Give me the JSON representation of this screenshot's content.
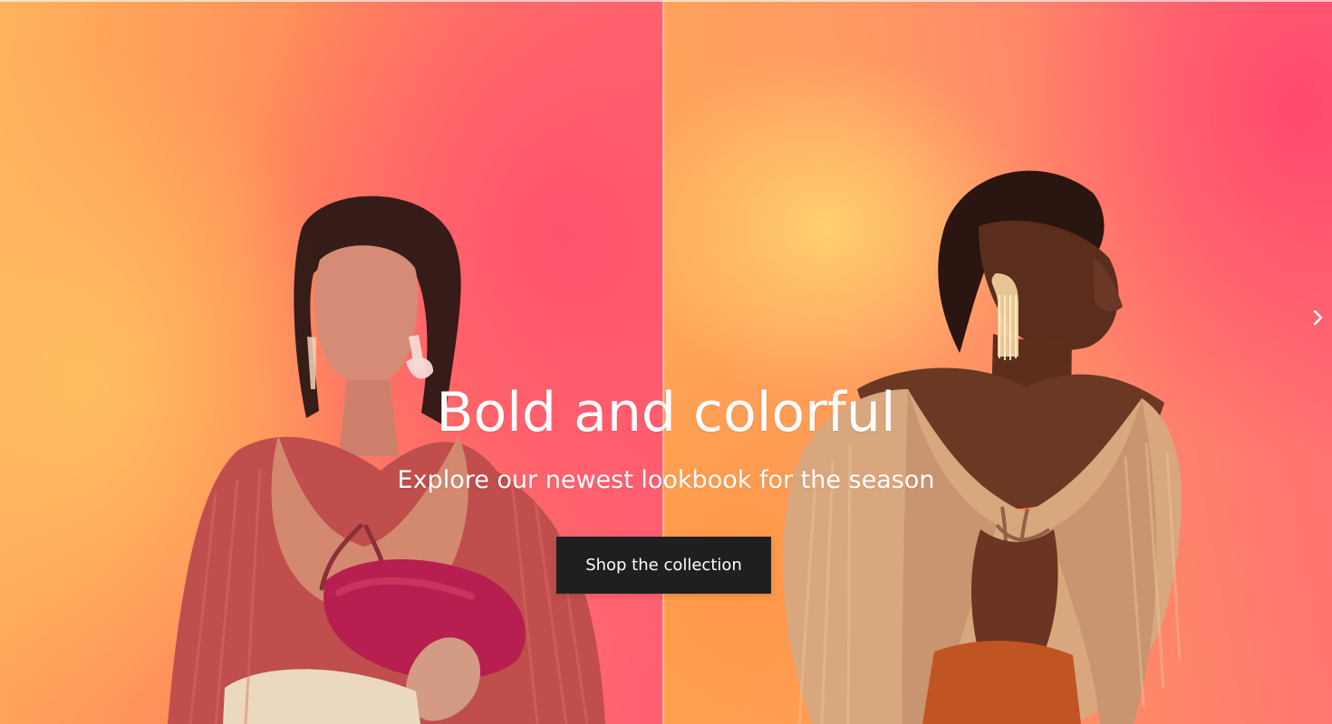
{
  "hero": {
    "title": "Bold and colorful",
    "subtitle": "Explore our newest lookbook for the season",
    "cta_label": "Shop the collection"
  },
  "controls": {
    "next_icon": "chevron-right-icon"
  },
  "colors": {
    "button_bg": "#1f1f20",
    "text": "#ffffff",
    "left_background": "#ff8d5a",
    "right_background": "#ff9863"
  }
}
